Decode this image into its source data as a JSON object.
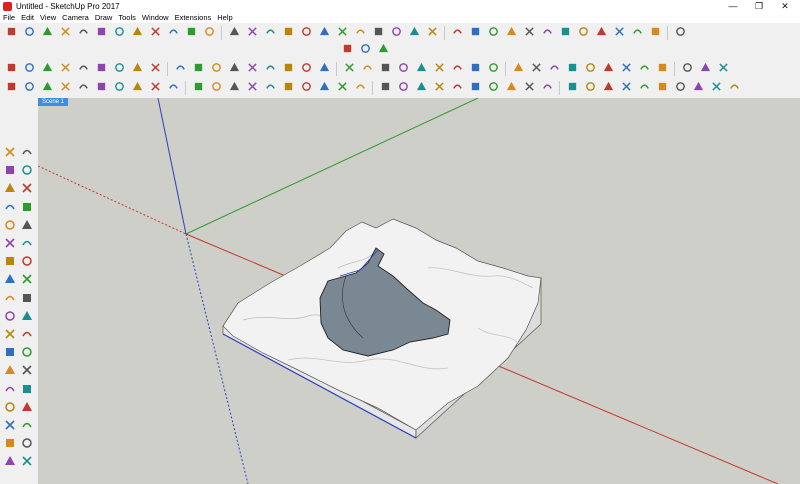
{
  "window": {
    "title": "Untitled - SketchUp Pro 2017",
    "minimize_glyph": "—",
    "maximize_glyph": "❐",
    "close_glyph": "✕"
  },
  "menu": {
    "items": [
      "File",
      "Edit",
      "View",
      "Camera",
      "Draw",
      "Tools",
      "Window",
      "Extensions",
      "Help"
    ]
  },
  "scene": {
    "tab_label": "Scene 1"
  },
  "colors": {
    "viewport_bg": "#cfcfc9",
    "axis_red": "#c0392b",
    "axis_green": "#2e9b2e",
    "axis_blue": "#2f3fbf",
    "terrain_snow": "#f2f2f2",
    "lake": "#7a8894",
    "scene_tab": "#3c8ee0",
    "app_red": "#d8261f"
  },
  "icons": {
    "toolbar_row1": [
      "rotate-icon",
      "undo-icon",
      "redo-icon",
      "cut-icon",
      "erase-icon",
      "paint-icon",
      "push-pull-icon",
      "move-icon",
      "orbit-icon",
      "pan-icon",
      "zoom-icon",
      "section-icon",
      "line-icon",
      "arc-icon",
      "circle-icon",
      "rect-icon",
      "tape-icon",
      "protractor-icon",
      "text-icon",
      "axes-icon",
      "dim-icon",
      "follow-icon",
      "offset-icon",
      "scale-icon",
      "walk-icon",
      "look-icon",
      "position-icon",
      "shadow-icon",
      "fog-icon",
      "style-icon",
      "layers-icon",
      "outliner-icon",
      "components-icon",
      "materials-icon",
      "entity-icon",
      "solid-icon",
      "sandbox-icon"
    ],
    "toolbar_row2": [
      "map-icon",
      "location-icon",
      "download-icon"
    ],
    "toolbar_row3": [
      "paint-bucket-icon",
      "paint-brush-icon",
      "solid-union-icon",
      "solid-subtract-icon",
      "solid-trim-icon",
      "solid-split-icon",
      "solid-shell-icon",
      "solid-outer-icon",
      "arc-tool-icon",
      "pie-icon",
      "tag-icon",
      "push-icon",
      "drape-icon",
      "iso-view-icon",
      "top-view-icon",
      "front-view-icon",
      "right-view-icon",
      "back-view-icon",
      "left-view-icon",
      "home-icon",
      "red-sphere-icon",
      "blue-sphere-icon",
      "teal-sphere-icon",
      "face-style-icon",
      "wire-style-icon",
      "hidden-icon",
      "shaded-icon",
      "textured-icon",
      "mono-icon",
      "xray-icon",
      "back-edges-icon",
      "section-plane-icon",
      "section-cut-icon",
      "section-fill-icon",
      "measure-icon",
      "gear-icon",
      "soccer-icon",
      "globe-icon",
      "bubble-icon"
    ],
    "toolbar_row4": [
      "extension-1-icon",
      "extension-2-icon",
      "extension-3-icon",
      "extension-4-icon",
      "extension-5-icon",
      "extension-6-icon",
      "extension-7-icon",
      "extension-8-icon",
      "extension-9-icon",
      "extension-10-icon",
      "extension-11-icon",
      "extension-12-icon",
      "extension-13-icon",
      "extension-14-icon",
      "extension-15-icon",
      "extension-16-icon",
      "extension-17-icon",
      "extension-18-icon",
      "extension-19-icon",
      "extension-20-icon",
      "extension-21-icon",
      "extension-22-icon",
      "extension-23-icon",
      "extension-24-icon",
      "extension-25-icon",
      "extension-26-icon",
      "extension-27-icon",
      "extension-28-icon",
      "extension-29-icon",
      "extension-30-icon",
      "extension-31-icon",
      "extension-32-icon",
      "extension-33-icon",
      "extension-34-icon",
      "extension-35-icon",
      "extension-36-icon",
      "extension-37-icon",
      "extension-38-icon",
      "extension-39-icon",
      "extension-40-icon"
    ],
    "left_tools": [
      "select-icon",
      "make-component-icon",
      "paint-bucket-icon",
      "eraser-icon",
      "pencil-icon",
      "freehand-icon",
      "rectangle-icon",
      "rotated-rect-icon",
      "circle-icon",
      "polygon-icon",
      "arc-icon",
      "arc-2pt-icon",
      "pie-icon",
      "push-pull-icon",
      "move-icon",
      "follow-me-icon",
      "rotate-icon",
      "offset-icon",
      "scale-icon",
      "intersect-icon",
      "tape-measure-icon",
      "dimension-icon",
      "protractor-icon",
      "text-icon",
      "axes-icon",
      "3d-text-icon",
      "orbit-icon",
      "pan-icon",
      "zoom-icon",
      "zoom-window-icon",
      "zoom-extents-icon",
      "previous-icon",
      "position-camera-icon",
      "look-around-icon",
      "walk-icon",
      "section-plane-icon"
    ]
  }
}
